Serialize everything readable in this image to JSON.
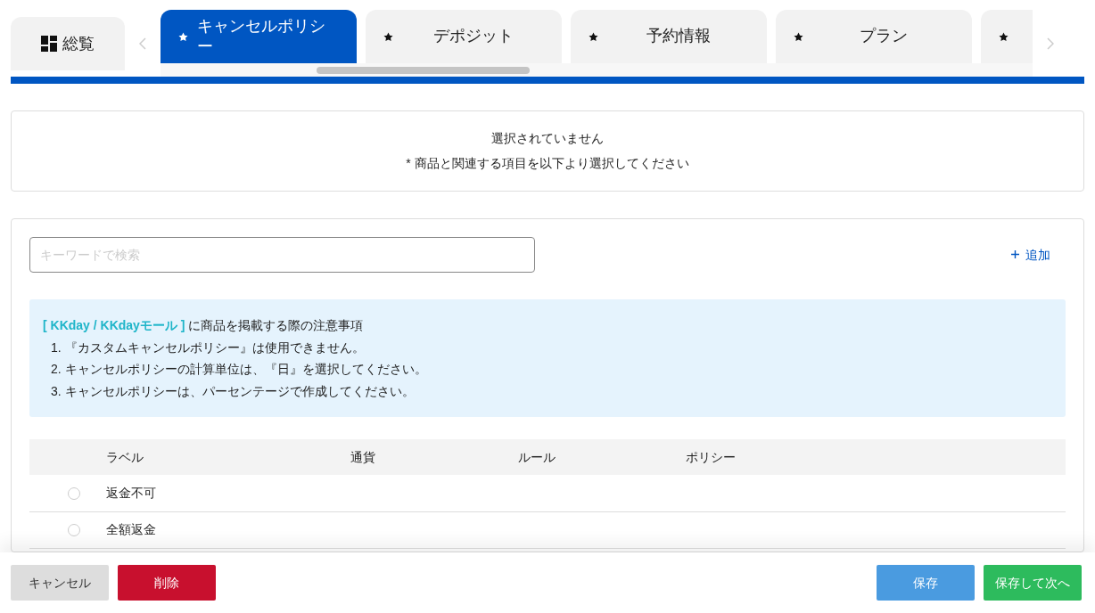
{
  "overview_tab": {
    "label": "総覧"
  },
  "tabs": [
    {
      "label": "キャンセルポリシー",
      "selected": true
    },
    {
      "label": "デポジット",
      "selected": false
    },
    {
      "label": "予約情報",
      "selected": false
    },
    {
      "label": "プラン",
      "selected": false
    },
    {
      "selected": false
    }
  ],
  "empty_notice": {
    "title": "選択されていません",
    "hint": "* 商品と関連する項目を以下より選択してください"
  },
  "search": {
    "placeholder": "キーワードで検索"
  },
  "add_link": {
    "label": "追加"
  },
  "notice": {
    "highlight": "[ KKday / KKdayモール ]",
    "title": "に商品を掲載する際の注意事項",
    "items": [
      "1. 『カスタムキャンセルポリシー』は使用できません。",
      "2. キャンセルポリシーの計算単位は、『日』を選択してください。",
      "3. キャンセルポリシーは、パーセンテージで作成してください。"
    ]
  },
  "table": {
    "columns": [
      "ラベル",
      "通貨",
      "ルール",
      "ポリシー"
    ],
    "rows": [
      {
        "label": "返金不可",
        "selected": false
      },
      {
        "label": "全額返金",
        "selected": false
      }
    ]
  },
  "footer": {
    "cancel": "キャンセル",
    "delete": "削除",
    "save": "保存",
    "save_next": "保存して次へ"
  }
}
